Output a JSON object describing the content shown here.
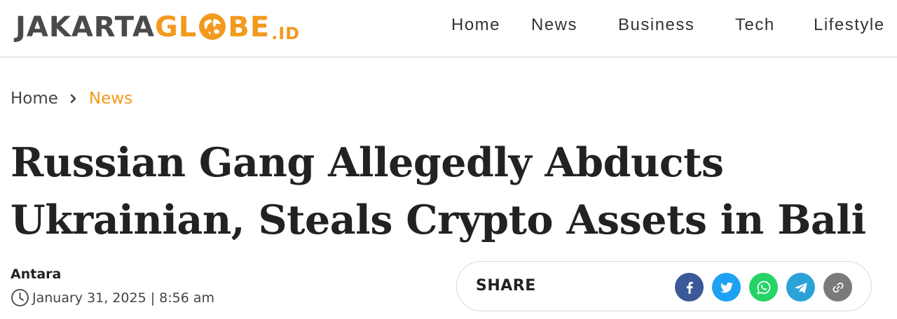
{
  "logo": {
    "part1": "JAKARTA",
    "part2a": "GL",
    "part2b": "BE",
    "suffix": ".ID",
    "icon": "globe-icon"
  },
  "nav": {
    "items": [
      {
        "label": "Home"
      },
      {
        "label": "News"
      },
      {
        "label": "Business"
      },
      {
        "label": "Tech"
      },
      {
        "label": "Lifestyle"
      }
    ]
  },
  "breadcrumb": {
    "home": "Home",
    "separator_icon": "chevron-right-icon",
    "current": "News"
  },
  "article": {
    "headline_line1": "Russian Gang Allegedly Abducts",
    "headline_line2": "Ukrainian, Steals Crypto Assets in Bali",
    "author": "Antara",
    "date": "January 31, 2025 | 8:56 am"
  },
  "share": {
    "label": "SHARE",
    "buttons": [
      {
        "name": "facebook-icon",
        "color": "#3b5998"
      },
      {
        "name": "twitter-icon",
        "color": "#1da1f2"
      },
      {
        "name": "whatsapp-icon",
        "color": "#25d366"
      },
      {
        "name": "telegram-icon",
        "color": "#2aa3d8"
      },
      {
        "name": "link-icon",
        "color": "#7a7a7a"
      }
    ]
  },
  "colors": {
    "brand_orange": "#f29a1d",
    "logo_gray": "#4a4a4a",
    "text_dark": "#222222"
  }
}
